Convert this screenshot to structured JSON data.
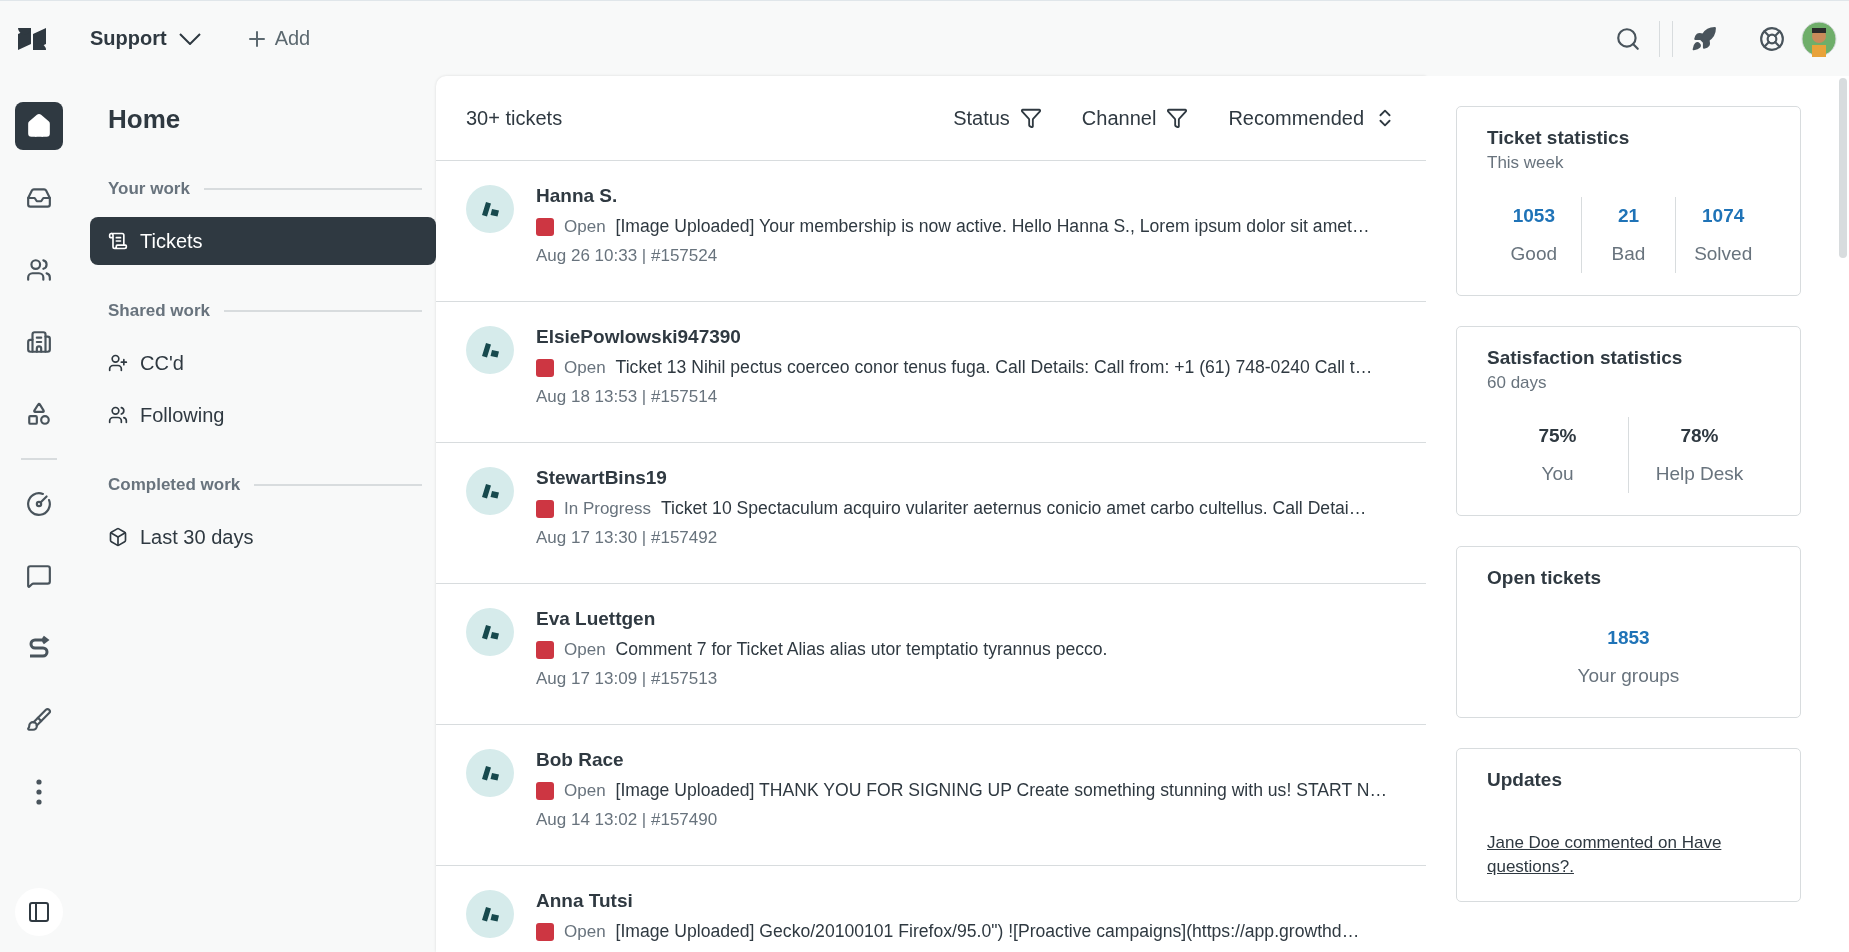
{
  "topbar": {
    "product": "Support",
    "add_label": "Add"
  },
  "rail": [
    {
      "kind": "home",
      "selected": true
    },
    {
      "kind": "inbox",
      "selected": false
    },
    {
      "kind": "users",
      "selected": false
    },
    {
      "kind": "building",
      "selected": false
    },
    {
      "kind": "shapes",
      "selected": false
    },
    {
      "kind": "gauge",
      "selected": false
    },
    {
      "kind": "video",
      "selected": false
    },
    {
      "kind": "swoosh",
      "selected": false
    },
    {
      "kind": "broom",
      "selected": false
    },
    {
      "kind": "more",
      "selected": false
    }
  ],
  "nav": {
    "title": "Home",
    "sections": [
      {
        "heading": "Your work",
        "items": [
          {
            "label": "Tickets",
            "kind": "tickets",
            "selected": true
          }
        ]
      },
      {
        "heading": "Shared work",
        "items": [
          {
            "label": "CC'd",
            "kind": "cc",
            "selected": false
          },
          {
            "label": "Following",
            "kind": "following",
            "selected": false
          }
        ]
      },
      {
        "heading": "Completed work",
        "items": [
          {
            "label": "Last 30 days",
            "kind": "box",
            "selected": false
          }
        ]
      }
    ]
  },
  "ticket_list": {
    "count": "30+ tickets",
    "filters": [
      {
        "label": "Status",
        "kind": "filter"
      },
      {
        "label": "Channel",
        "kind": "filter"
      },
      {
        "label": "Recommended",
        "kind": "sort"
      }
    ],
    "tickets": [
      {
        "requester": "Hanna S.",
        "status": "Open",
        "color": "#cd3642",
        "summary": "[Image Uploaded] Your membership is now active. Hello Hanna S., Lorem ipsum dolor sit amet…",
        "meta": "Aug 26 10:33 | #157524"
      },
      {
        "requester": "ElsiePowlowski947390",
        "status": "Open",
        "color": "#cd3642",
        "summary": "Ticket 13 Nihil pectus coerceo conor tenus fuga. Call Details: Call from: +1 (61) 748-0240 Call t…",
        "meta": "Aug 18 13:53 | #157514"
      },
      {
        "requester": "StewartBins19",
        "status": "In Progress",
        "color": "#cd3642",
        "summary": "Ticket 10 Spectaculum acquiro vulariter aeternus conicio amet carbo cultellus. Call Detai…",
        "meta": "Aug 17 13:30 | #157492"
      },
      {
        "requester": "Eva Luettgen",
        "status": "Open",
        "color": "#cd3642",
        "summary": "Comment 7 for Ticket Alias alias utor temptatio tyrannus pecco.",
        "meta": "Aug 17 13:09 | #157513"
      },
      {
        "requester": "Bob Race",
        "status": "Open",
        "color": "#cd3642",
        "summary": "[Image Uploaded] THANK YOU FOR SIGNING UP Create something stunning with us! START N…",
        "meta": "Aug 14 13:02 | #157490"
      },
      {
        "requester": "Anna Tutsi",
        "status": "Open",
        "color": "#cd3642",
        "summary": "[Image Uploaded] Gecko/20100101 Firefox/95.0\") ![Proactive campaigns](https://app.growthd…"
      }
    ]
  },
  "cards": [
    {
      "kind": "stats",
      "title": "Ticket statistics",
      "subtitle": "This week",
      "stats": [
        {
          "value": "1053",
          "label": "Good"
        },
        {
          "value": "21",
          "label": "Bad"
        },
        {
          "value": "1074",
          "label": "Solved"
        }
      ]
    },
    {
      "kind": "satisfaction",
      "title": "Satisfaction statistics",
      "subtitle": "60 days",
      "stats": [
        {
          "value": "75%",
          "label": "You"
        },
        {
          "value": "78%",
          "label": "Help Desk"
        }
      ]
    },
    {
      "kind": "stats",
      "title": "Open tickets",
      "stats": [
        {
          "value": "1853",
          "label": "Your groups"
        }
      ]
    },
    {
      "kind": "updates",
      "title": "Updates",
      "link": "Jane Doe commented on Have questions?."
    }
  ]
}
